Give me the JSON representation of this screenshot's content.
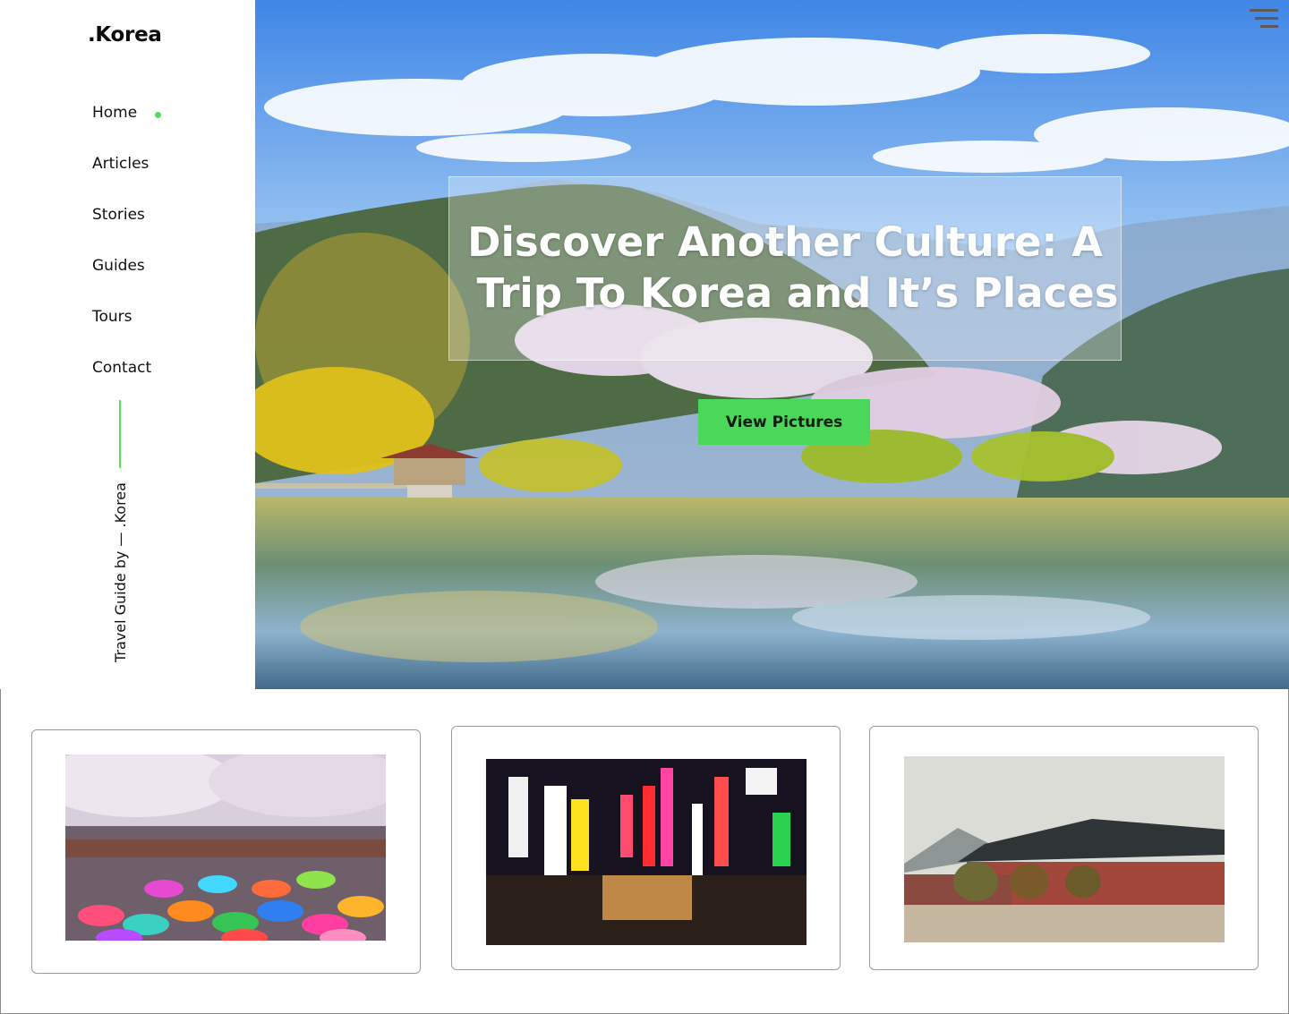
{
  "brand": {
    "logo": ".Korea"
  },
  "nav": {
    "items": [
      {
        "label": "Home",
        "active": true
      },
      {
        "label": "Articles"
      },
      {
        "label": "Stories"
      },
      {
        "label": "Guides"
      },
      {
        "label": "Tours"
      },
      {
        "label": "Contact"
      }
    ],
    "active_indicator_color": "#4fe050"
  },
  "sidebar": {
    "vertical_text": "Travel Guide by — .Korea"
  },
  "hero": {
    "title_line1": "Discover Another Culture: A",
    "title_line2": "Trip To Korea and It’s Places",
    "button_label": "View Pictures",
    "button_color": "#4bd85a",
    "menu_icon": "hamburger-menu-icon"
  },
  "cards": [
    {
      "image": "cherry-blossom-umbrellas-photo"
    },
    {
      "image": "night-street-neon-signs-photo"
    },
    {
      "image": "traditional-palace-photo"
    }
  ]
}
